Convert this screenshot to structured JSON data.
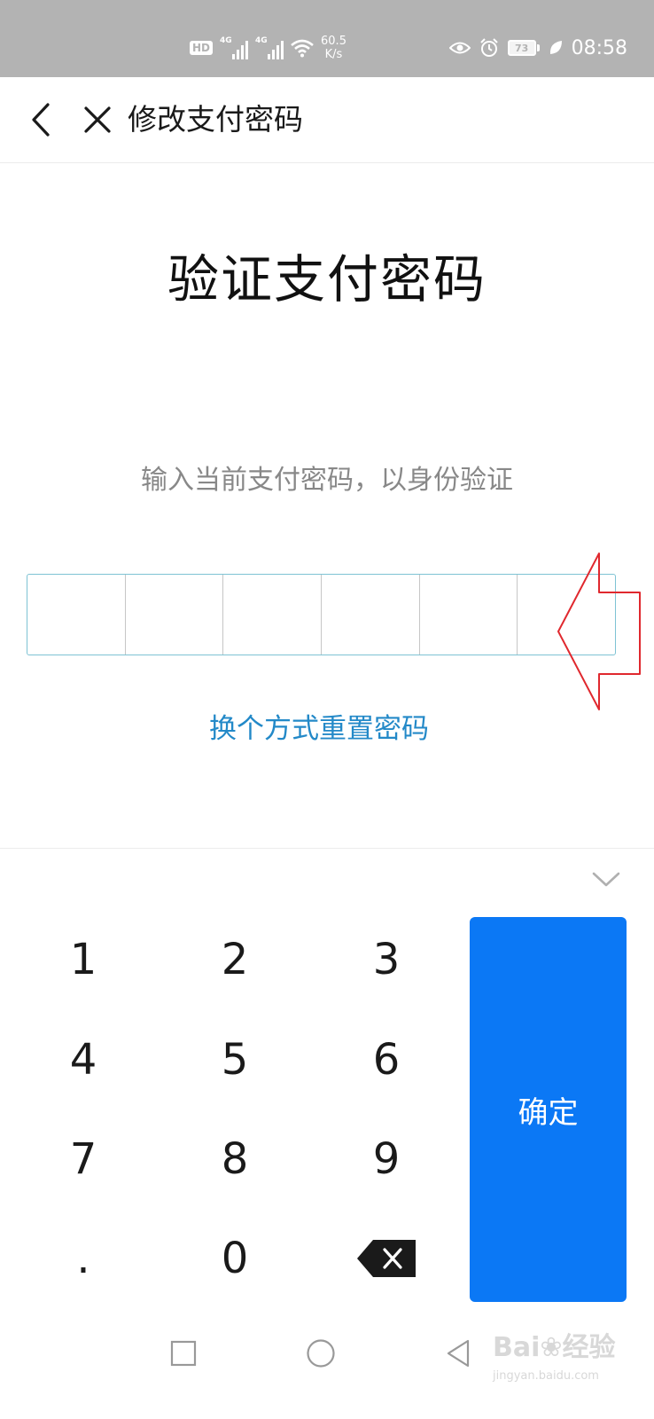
{
  "status_bar": {
    "hd_label": "HD",
    "signal1_label": "4G",
    "signal2_label": "4G",
    "net_speed_value": "60.5",
    "net_speed_unit": "K/s",
    "battery": "73",
    "time": "08:58"
  },
  "header": {
    "title": "修改支付密码"
  },
  "main": {
    "heading": "验证支付密码",
    "hint": "输入当前支付密码，以身份验证",
    "password_cells": 6,
    "reset_link": "换个方式重置密码"
  },
  "keypad": {
    "keys": [
      "1",
      "2",
      "3",
      "4",
      "5",
      "6",
      "7",
      "8",
      "9",
      ".",
      "0"
    ],
    "confirm_label": "确定"
  },
  "watermark": {
    "main": "Bai",
    "main2": "经验",
    "sub": "jingyan.baidu.com"
  },
  "colors": {
    "accent": "#0b78f5",
    "link": "#2389c8",
    "annotation": "#e0282e",
    "status_bar_bg": "#b3b3b3"
  },
  "icons": {
    "back": "back-arrow-icon",
    "close": "close-icon",
    "collapse": "chevron-down-icon",
    "delete": "backspace-icon"
  }
}
